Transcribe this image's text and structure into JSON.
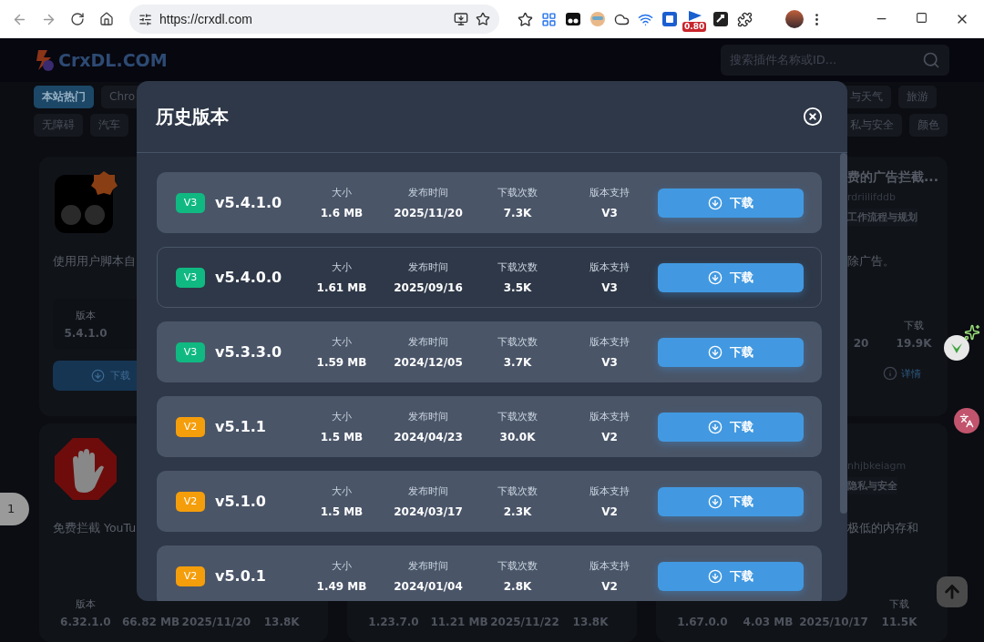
{
  "browser": {
    "url": "https://crxdl.com",
    "extension_badge": "0.80"
  },
  "site_header": {
    "logo": "CrxDL.COM",
    "search": {
      "placeholder": "搜索插件名称或ID..."
    }
  },
  "categories": {
    "left_rows": [
      [
        {
          "label": "本站热门",
          "selected": true
        },
        {
          "label": "Chro",
          "selected": false
        }
      ],
      [
        {
          "label": "无障碍",
          "selected": false
        },
        {
          "label": "汽车",
          "selected": false
        }
      ]
    ],
    "right_rows": [
      [
        {
          "label": "与天气",
          "selected": false
        },
        {
          "label": "旅游",
          "selected": false
        }
      ],
      [
        {
          "label": "私与安全",
          "selected": false
        },
        {
          "label": "颜色",
          "selected": false
        }
      ]
    ]
  },
  "cards": {
    "left": [
      {
        "kind": "top",
        "description": "使用用户脚本自",
        "stat": {
          "label": "版本",
          "value": "5.4.1.0"
        },
        "button": "下载"
      },
      {
        "kind": "bottom",
        "description": "免费拦截 YouTu",
        "stats": [
          {
            "label": "版本",
            "value": "6.32.1.0"
          },
          {
            "value": "66.82 MB"
          },
          {
            "value": "2025/11/20"
          },
          {
            "value": "13.8K"
          }
        ]
      }
    ],
    "middle": [
      {
        "kind": "bottom",
        "stats": [
          {
            "value": "1.23.7.0"
          },
          {
            "value": "11.21 MB"
          },
          {
            "value": "2025/11/22"
          },
          {
            "value": "13.8K"
          }
        ]
      }
    ],
    "right": [
      {
        "kind": "top",
        "title": "费的广告拦截...",
        "id": "rdriilifddb",
        "tag": "工作流程与规划",
        "description": "除广告。",
        "date_part": "20",
        "downloads": {
          "label": "下载",
          "value": "19.9K"
        },
        "button": "详情"
      },
      {
        "kind": "bottom",
        "id": "nhjbkeiagm",
        "tag": "隐私与安全",
        "description": "极低的内存和",
        "stats": [
          {
            "value": "1.67.0.0"
          },
          {
            "value": "4.03 MB"
          },
          {
            "value": "2025/10/17"
          },
          {
            "label": "下载",
            "value": "11.5K"
          }
        ]
      }
    ]
  },
  "page_indicator": "1",
  "modal": {
    "title": "历史版本",
    "versions": [
      {
        "badge": "V3",
        "color": "#10b981",
        "version": "v5.4.1.0",
        "selected": false,
        "stats": [
          {
            "label": "大小",
            "value": "1.6 MB"
          },
          {
            "label": "发布时间",
            "value": "2025/11/20"
          },
          {
            "label": "下载次数",
            "value": "7.3K"
          },
          {
            "label": "版本支持",
            "value": "V3"
          }
        ],
        "button": "下载"
      },
      {
        "badge": "V3",
        "color": "#10b981",
        "version": "v5.4.0.0",
        "selected": true,
        "stats": [
          {
            "label": "大小",
            "value": "1.61 MB"
          },
          {
            "label": "发布时间",
            "value": "2025/09/16"
          },
          {
            "label": "下载次数",
            "value": "3.5K"
          },
          {
            "label": "版本支持",
            "value": "V3"
          }
        ],
        "button": "下载"
      },
      {
        "badge": "V3",
        "color": "#10b981",
        "version": "v5.3.3.0",
        "selected": false,
        "stats": [
          {
            "label": "大小",
            "value": "1.59 MB"
          },
          {
            "label": "发布时间",
            "value": "2024/12/05"
          },
          {
            "label": "下载次数",
            "value": "3.7K"
          },
          {
            "label": "版本支持",
            "value": "V3"
          }
        ],
        "button": "下载"
      },
      {
        "badge": "V2",
        "color": "#f59e0b",
        "version": "v5.1.1",
        "selected": false,
        "stats": [
          {
            "label": "大小",
            "value": "1.5 MB"
          },
          {
            "label": "发布时间",
            "value": "2024/04/23"
          },
          {
            "label": "下载次数",
            "value": "30.0K"
          },
          {
            "label": "版本支持",
            "value": "V2"
          }
        ],
        "button": "下载"
      },
      {
        "badge": "V2",
        "color": "#f59e0b",
        "version": "v5.1.0",
        "selected": false,
        "stats": [
          {
            "label": "大小",
            "value": "1.5 MB"
          },
          {
            "label": "发布时间",
            "value": "2024/03/17"
          },
          {
            "label": "下载次数",
            "value": "2.3K"
          },
          {
            "label": "版本支持",
            "value": "V2"
          }
        ],
        "button": "下载"
      },
      {
        "badge": "V2",
        "color": "#f59e0b",
        "version": "v5.0.1",
        "selected": false,
        "stats": [
          {
            "label": "大小",
            "value": "1.49 MB"
          },
          {
            "label": "发布时间",
            "value": "2024/01/04"
          },
          {
            "label": "下载次数",
            "value": "2.8K"
          },
          {
            "label": "版本支持",
            "value": "V2"
          }
        ],
        "button": "下载"
      }
    ]
  }
}
